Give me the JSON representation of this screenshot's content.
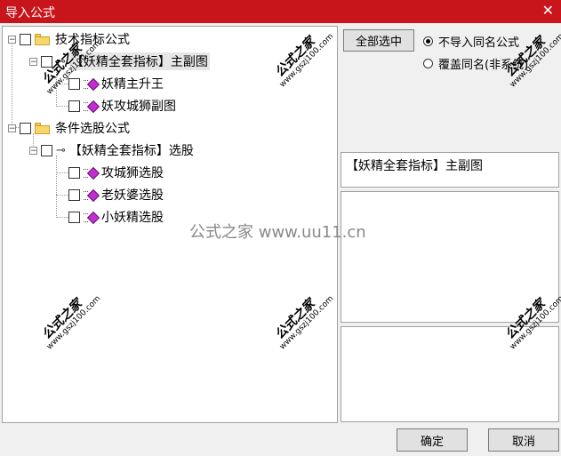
{
  "window": {
    "title": "导入公式",
    "close_glyph": "✕"
  },
  "tree": {
    "groups": [
      {
        "label": "技术指标公式",
        "expander": "⊟",
        "children": [
          {
            "label": "【妖精全套指标】主副图",
            "selected": true,
            "children": [
              {
                "label": "妖精主升王"
              },
              {
                "label": "妖攻城狮副图"
              }
            ]
          }
        ]
      },
      {
        "label": "条件选股公式",
        "expander": "⊟",
        "children": [
          {
            "label": "【妖精全套指标】选股",
            "children": [
              {
                "label": "攻城狮选股"
              },
              {
                "label": "老妖婆选股"
              },
              {
                "label": "小妖精选股"
              }
            ]
          }
        ]
      }
    ]
  },
  "right": {
    "select_all_label": "全部选中",
    "radio_options": [
      {
        "label": "不导入同名公式",
        "checked": true
      },
      {
        "label": "覆盖同名(非系统)",
        "checked": false
      }
    ],
    "selected_formula": "【妖精全套指标】主副图"
  },
  "footer": {
    "ok_label": "确定",
    "cancel_label": "取消"
  },
  "watermark": {
    "stamp_text": "公式之家",
    "stamp_url": "www.gszj100.com",
    "center_text": "公式之家 www.uu11.cn"
  }
}
